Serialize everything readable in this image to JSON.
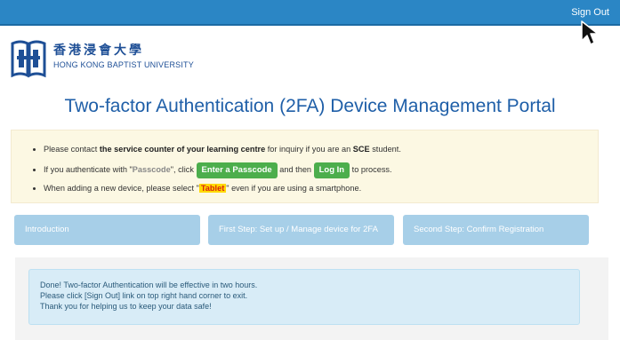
{
  "header": {
    "signout_label": "Sign Out",
    "bar_color": "#2b86c5"
  },
  "logo": {
    "chinese_name": "香港浸會大學",
    "english_name": "HONG KONG BAPTIST UNIVERSITY",
    "brand_color": "#1e4f96"
  },
  "page": {
    "title": "Two-factor Authentication (2FA) Device Management Portal",
    "title_color": "#1f5fa8"
  },
  "notice": {
    "line1_prefix": "Please contact ",
    "line1_bold": "the service counter of your learning centre",
    "line1_middle": " for inquiry if you are an ",
    "line1_sce": "SCE",
    "line1_suffix": " student.",
    "line2_prefix": "If you authenticate with \"",
    "line2_passcode": "Passcode",
    "line2_mid1": "\", click ",
    "line2_button1": "Enter a Passcode",
    "line2_mid2": " and then ",
    "line2_button2": "Log In",
    "line2_suffix": " to process.",
    "line3_prefix": "When adding a new device, please select \"",
    "line3_tablet": "Tablet",
    "line3_suffix": "\" even if you are using a smartphone."
  },
  "steps": [
    {
      "label": "Introduction"
    },
    {
      "label": "First Step: Set up / Manage device for 2FA"
    },
    {
      "label": "Second Step: Confirm Registration"
    }
  ],
  "result": {
    "line1": "Done! Two-factor Authentication will be effective in two hours.",
    "line2": "Please click [Sign Out] link on top right hand corner to exit.",
    "line3": "Thank you for helping us to keep your data safe!"
  }
}
